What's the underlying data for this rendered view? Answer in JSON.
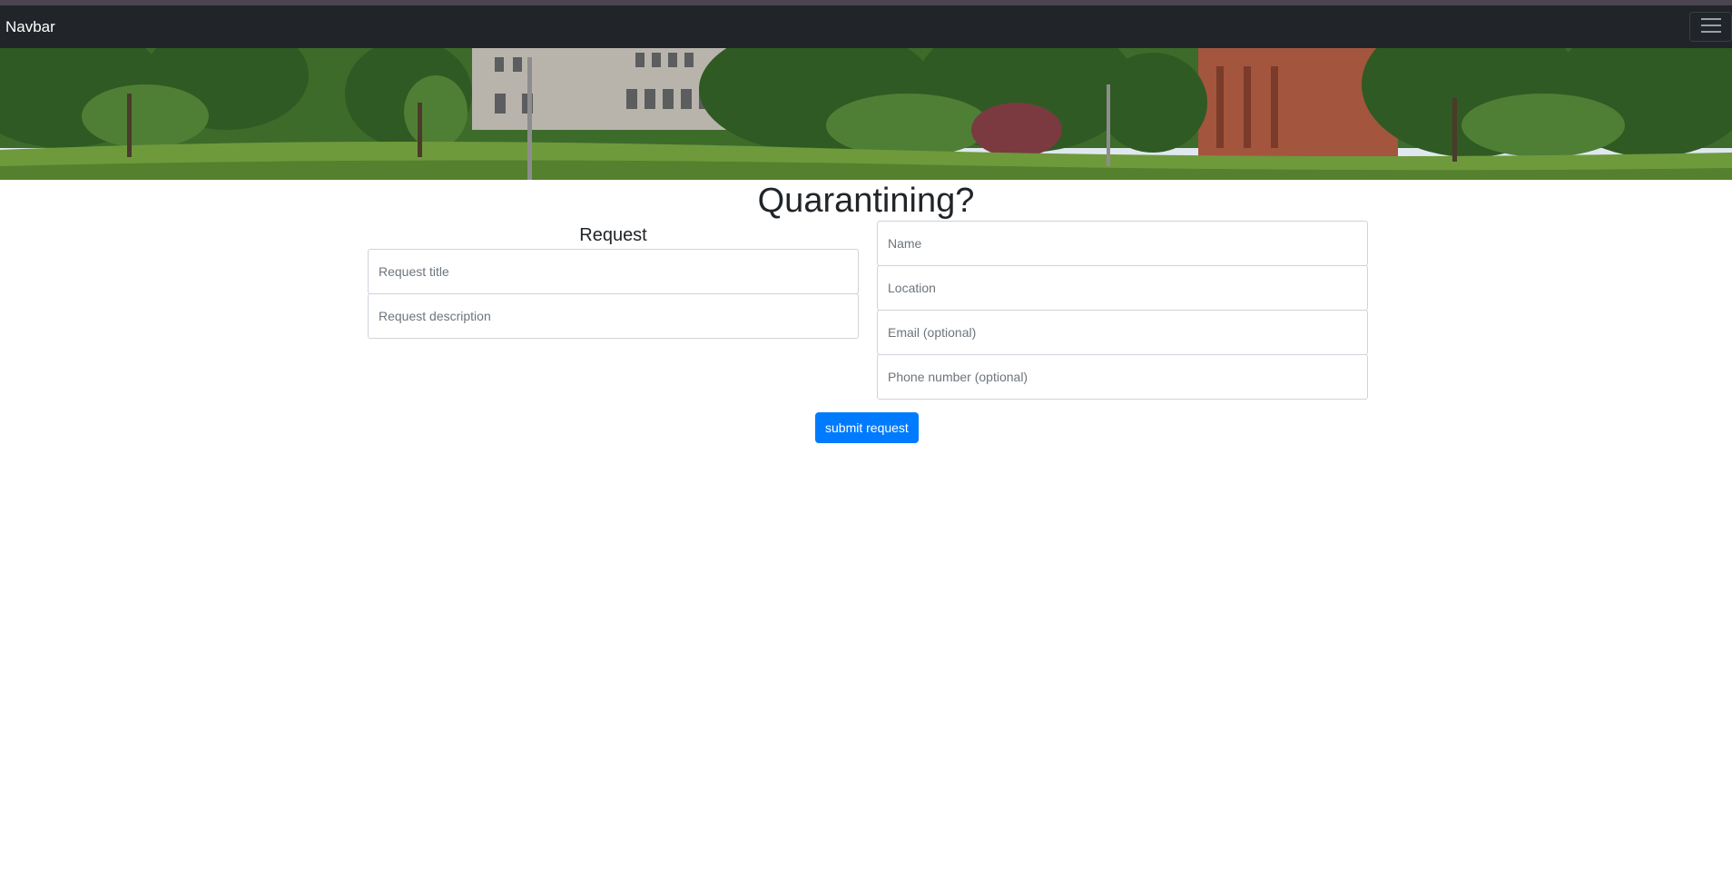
{
  "navbar": {
    "brand": "Navbar",
    "toggler_icon": "hamburger-icon"
  },
  "banner": {
    "description_icon": "campus-photo",
    "colors": {
      "sky": "#dfe8ef",
      "grass": "#6e9a3c",
      "trees": "#2f5a23",
      "building_stone": "#b8b4ac",
      "building_brick": "#a4553d"
    }
  },
  "main": {
    "title": "Quarantining?",
    "request_section": {
      "heading": "Request",
      "title_placeholder": "Request title",
      "title_value": "",
      "description_placeholder": "Request description",
      "description_value": ""
    },
    "contact_section": {
      "name_placeholder": "Name",
      "name_value": "",
      "location_placeholder": "Location",
      "location_value": "",
      "email_placeholder": "Email (optional)",
      "email_value": "",
      "phone_placeholder": "Phone number (optional)",
      "phone_value": ""
    },
    "submit_label": "submit request"
  },
  "colors": {
    "navbar_bg": "#212529",
    "primary": "#007bff",
    "border": "#ced4da"
  }
}
